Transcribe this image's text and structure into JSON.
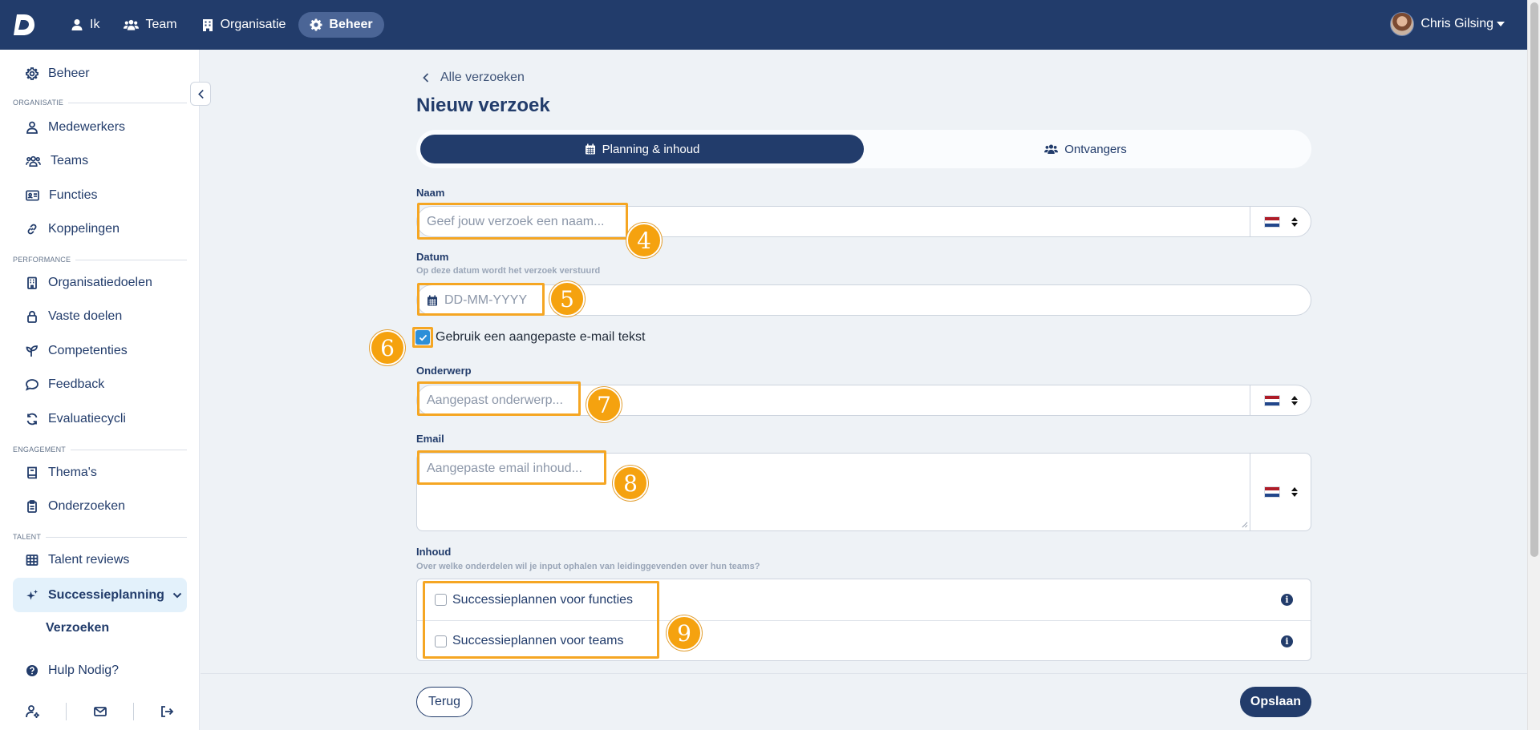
{
  "topbar": {
    "logo_letter": "D",
    "nav": [
      {
        "label": "Ik",
        "icon": "user-icon"
      },
      {
        "label": "Team",
        "icon": "users-icon"
      },
      {
        "label": "Organisatie",
        "icon": "building-icon"
      },
      {
        "label": "Beheer",
        "icon": "gear-icon",
        "active": true
      }
    ],
    "user_name": "Chris Gilsing"
  },
  "sidebar": {
    "top_item": "Beheer",
    "sections": {
      "organisatie": "ORGANISATIE",
      "performance": "PERFORMANCE",
      "engagement": "ENGAGEMENT",
      "talent": "TALENT"
    },
    "items": {
      "medewerkers": "Medewerkers",
      "teams": "Teams",
      "functies": "Functies",
      "koppelingen": "Koppelingen",
      "organisatiedoelen": "Organisatiedoelen",
      "vaste_doelen": "Vaste doelen",
      "competenties": "Competenties",
      "feedback": "Feedback",
      "evaluatiecycli": "Evaluatiecycli",
      "themas": "Thema's",
      "onderzoeken": "Onderzoeken",
      "talent_reviews": "Talent reviews",
      "successieplanning": "Successieplanning",
      "verzoeken": "Verzoeken"
    },
    "help": "Hulp Nodig?"
  },
  "main": {
    "back_link": "Alle verzoeken",
    "title": "Nieuw verzoek",
    "tabs": [
      {
        "label": "Planning & inhoud",
        "active": true
      },
      {
        "label": "Ontvangers",
        "active": false
      }
    ],
    "naam": {
      "label": "Naam",
      "placeholder": "Geef jouw verzoek een naam..."
    },
    "datum": {
      "label": "Datum",
      "hint": "Op deze datum wordt het verzoek verstuurd",
      "placeholder": "DD-MM-YYYY"
    },
    "custom_email": {
      "label": "Gebruik een aangepaste e-mail tekst",
      "checked": true
    },
    "onderwerp": {
      "label": "Onderwerp",
      "placeholder": "Aangepast onderwerp..."
    },
    "email": {
      "label": "Email",
      "placeholder": "Aangepaste email inhoud..."
    },
    "inhoud": {
      "label": "Inhoud",
      "hint": "Over welke onderdelen wil je input ophalen van leidinggevenden over hun teams?",
      "options": [
        "Successieplannen voor functies",
        "Successieplannen voor teams"
      ]
    },
    "buttons": {
      "back": "Terug",
      "save": "Opslaan"
    }
  },
  "markers": [
    "4",
    "5",
    "6",
    "7",
    "8",
    "9"
  ],
  "colors": {
    "primary": "#223c6b",
    "highlight": "#f5a623",
    "checkbox": "#2d8fd8"
  }
}
